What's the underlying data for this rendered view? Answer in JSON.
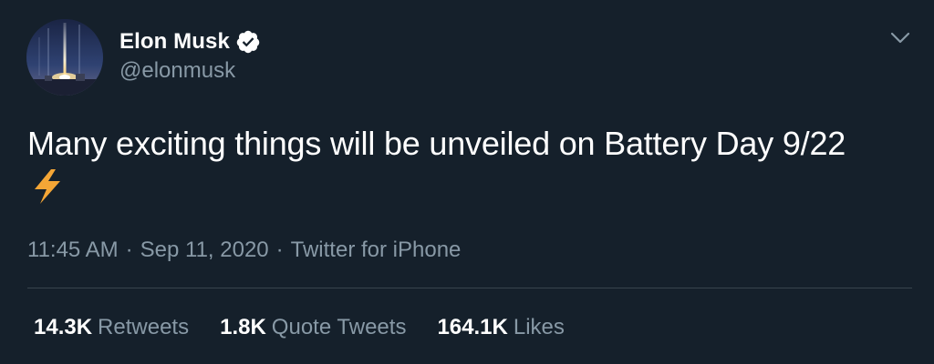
{
  "author": {
    "display_name": "Elon Musk",
    "handle": "@elonmusk",
    "verified": true,
    "avatar_icon": "rocket-launch-avatar"
  },
  "menu_icon": "chevron-down-icon",
  "tweet": {
    "text": "Many exciting things will be unveiled on Battery Day 9/22",
    "emoji": "high-voltage-emoji"
  },
  "meta": {
    "time": "11:45 AM",
    "separator": "·",
    "date": "Sep 11, 2020",
    "source": "Twitter for iPhone"
  },
  "stats": {
    "retweets_count": "14.3K",
    "retweets_label": "Retweets",
    "quote_count": "1.8K",
    "quote_label": "Quote Tweets",
    "likes_count": "164.1K",
    "likes_label": "Likes"
  },
  "colors": {
    "background": "#15202b",
    "primary_text": "#ffffff",
    "secondary_text": "#8899a6",
    "divider": "#38444d",
    "verified_badge": "#ffffff",
    "bolt": "#f4a636"
  }
}
